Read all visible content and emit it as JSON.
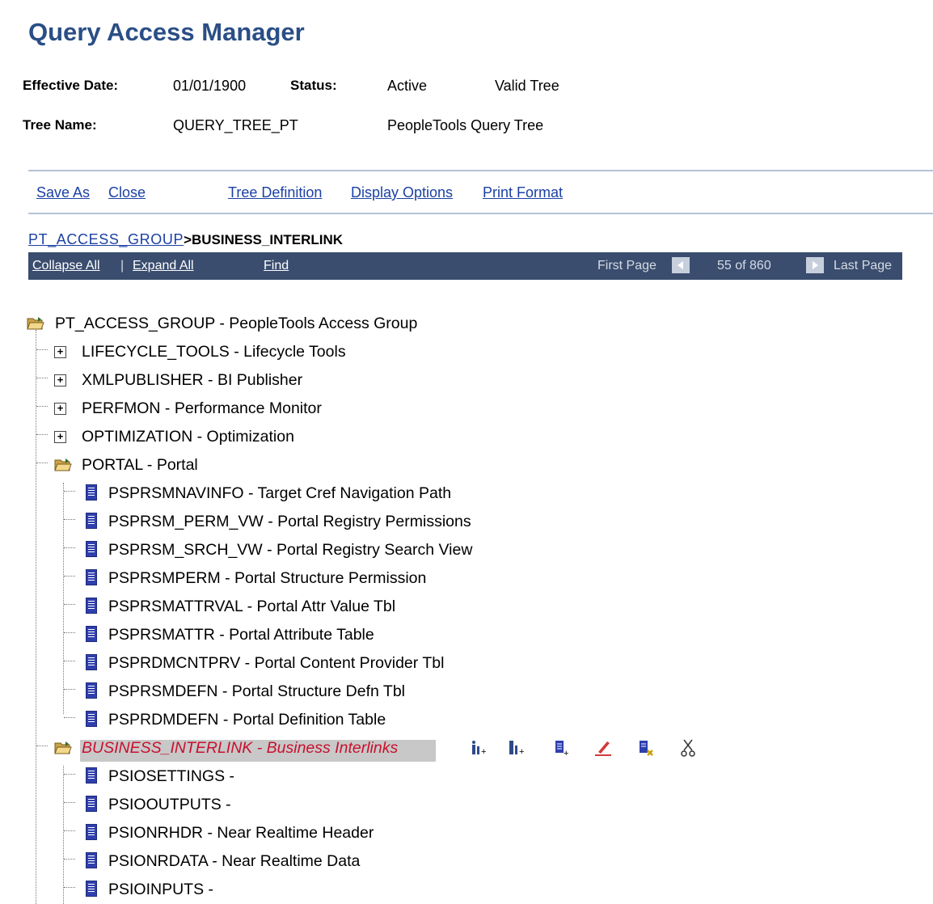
{
  "page": {
    "title": "Query Access Manager"
  },
  "header": {
    "effective_date_label": "Effective Date:",
    "effective_date": "01/01/1900",
    "status_label": "Status:",
    "status": "Active",
    "tree_validity": "Valid Tree",
    "tree_name_label": "Tree Name:",
    "tree_name": "QUERY_TREE_PT",
    "tree_description": "PeopleTools Query Tree"
  },
  "actions": {
    "save_as": "Save As",
    "close": "Close",
    "tree_definition": "Tree Definition",
    "display_options": "Display Options",
    "print_format": "Print Format"
  },
  "breadcrumb": {
    "parent": "PT_ACCESS_GROUP",
    "current": ">BUSINESS_INTERLINK"
  },
  "navbar": {
    "collapse_all": "Collapse All",
    "separator": "|",
    "expand_all": "Expand All",
    "find": "Find",
    "first_page": "First Page",
    "page_info": "55 of 860",
    "last_page": "Last Page"
  },
  "tree": {
    "root": "PT_ACCESS_GROUP - PeopleTools Access Group",
    "collapsed_groups": [
      "LIFECYCLE_TOOLS - Lifecycle Tools",
      "XMLPUBLISHER - BI Publisher",
      "PERFMON - Performance Monitor",
      "OPTIMIZATION - Optimization"
    ],
    "portal": {
      "label": "PORTAL - Portal",
      "records": [
        "PSPRSMNAVINFO - Target Cref Navigation Path",
        "PSPRSM_PERM_VW - Portal Registry Permissions",
        "PSPRSM_SRCH_VW - Portal Registry Search View",
        "PSPRSMPERM - Portal Structure Permission",
        "PSPRSMATTRVAL - Portal Attr Value Tbl",
        "PSPRSMATTR - Portal Attribute Table",
        "PSPRDMCNTPRV - Portal Content Provider Tbl",
        "PSPRSMDEFN - Portal Structure Defn Tbl",
        "PSPRDMDEFN - Portal Definition Table"
      ]
    },
    "business_interlink": {
      "label": "BUSINESS_INTERLINK - Business Interlinks",
      "records": [
        "PSIOSETTINGS -",
        "PSIOOUTPUTS -",
        "PSIONRHDR - Near Realtime Header",
        "PSIONRDATA - Near Realtime Data",
        "PSIOINPUTS -"
      ]
    }
  },
  "node_tools": [
    "insert-sibling-group-icon",
    "insert-child-group-icon",
    "insert-record-icon",
    "edit-node-icon",
    "delete-node-icon",
    "cut-node-icon"
  ]
}
